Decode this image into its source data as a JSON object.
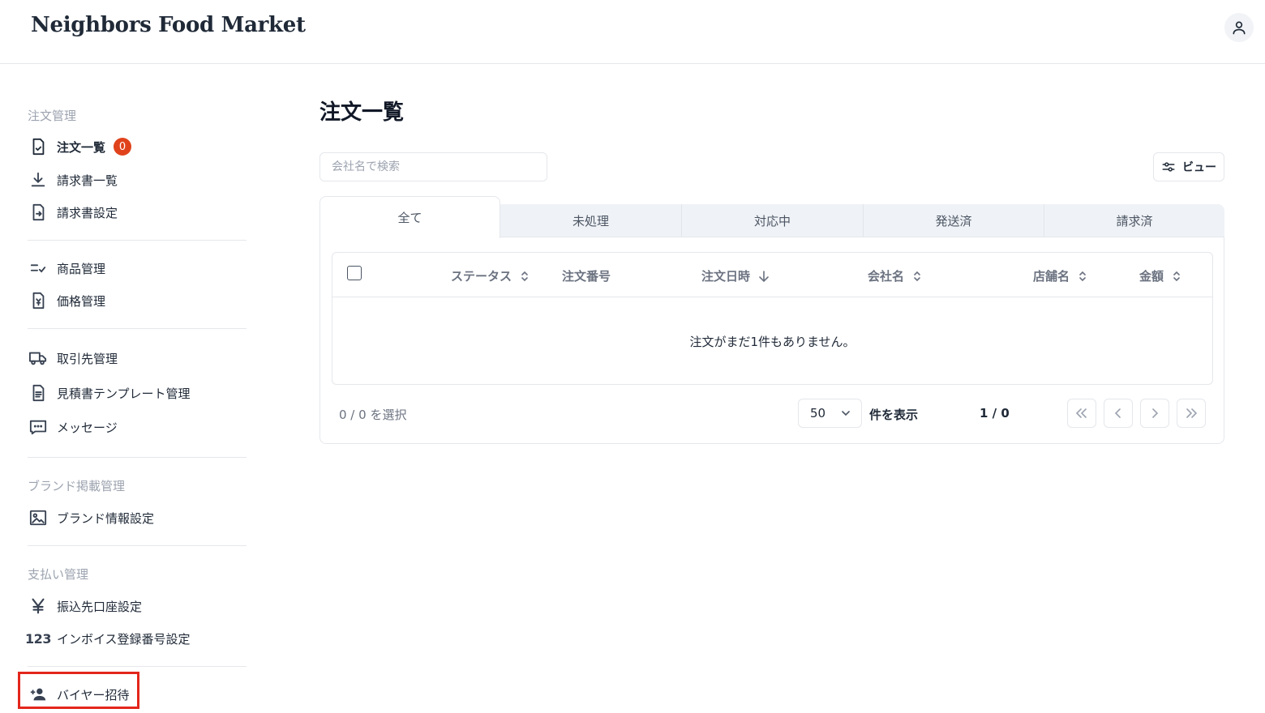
{
  "header": {
    "logo": "Neighbors Food Market",
    "account_icon": "user-icon"
  },
  "sidebar": {
    "order_section": "注文管理",
    "orders": {
      "label": "注文一覧",
      "badge": "0",
      "icon": "file-check-icon"
    },
    "invoices": {
      "label": "請求書一覧",
      "icon": "download-icon"
    },
    "invoice_settings": {
      "label": "請求書設定",
      "icon": "file-arrow-icon"
    },
    "products": {
      "label": "商品管理",
      "icon": "list-check-icon"
    },
    "prices": {
      "label": "価格管理",
      "icon": "file-yen-icon"
    },
    "partners": {
      "label": "取引先管理",
      "icon": "truck-icon"
    },
    "quote_templates": {
      "label": "見積書テンプレート管理",
      "icon": "document-icon"
    },
    "messages": {
      "label": "メッセージ",
      "icon": "message-icon"
    },
    "brand_section": "ブランド掲載管理",
    "brand_info": {
      "label": "ブランド情報設定",
      "icon": "image-icon"
    },
    "payment_section": "支払い管理",
    "bank_account": {
      "label": "振込先口座設定",
      "icon": "yen-icon"
    },
    "invoice_number": {
      "label": "インボイス登録番号設定",
      "icon_text": "123"
    },
    "invite_buyer": {
      "label": "バイヤー招待",
      "icon": "person-add-icon"
    }
  },
  "main": {
    "title": "注文一覧",
    "search_placeholder": "会社名で検索",
    "view_button": "ビュー",
    "tabs": [
      "全て",
      "未処理",
      "対応中",
      "発送済",
      "請求済"
    ],
    "active_tab": "全て",
    "columns": {
      "status": "ステータス",
      "order_number": "注文番号",
      "order_date": "注文日時",
      "company": "会社名",
      "store": "店舗名",
      "amount": "金額"
    },
    "empty_message": "注文がまだ1件もありません。",
    "selected": "0 / 0 を選択",
    "page_size": "50",
    "per_page_label": "件を表示",
    "page_indicator": "1 / 0"
  },
  "colors": {
    "badge": "#e0431c",
    "highlight": "#e3261c",
    "tab_bg": "#eff2f6"
  }
}
